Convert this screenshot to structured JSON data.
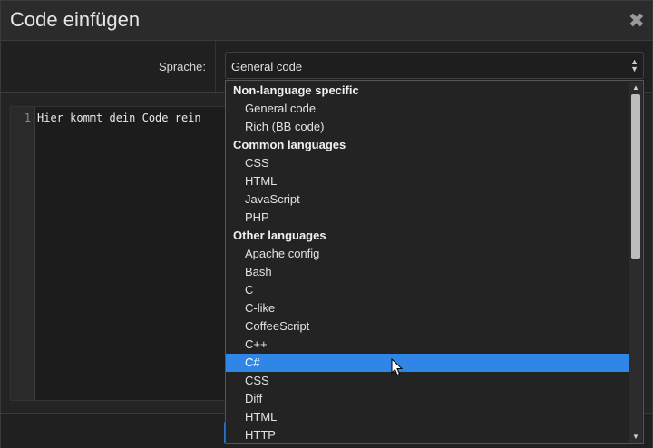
{
  "dialog": {
    "title": "Code einfügen",
    "close_glyph": "✖"
  },
  "form": {
    "language_label": "Sprache:",
    "language_value": "General code",
    "arrow_up": "▲",
    "arrow_down": "▼"
  },
  "editor": {
    "line_number": "1",
    "code": "Hier kommt dein Code rein"
  },
  "dropdown": {
    "options": [
      {
        "kind": "group",
        "label": "Non-language specific"
      },
      {
        "kind": "item",
        "label": "General code"
      },
      {
        "kind": "item",
        "label": "Rich (BB code)"
      },
      {
        "kind": "group",
        "label": "Common languages"
      },
      {
        "kind": "item",
        "label": "CSS"
      },
      {
        "kind": "item",
        "label": "HTML"
      },
      {
        "kind": "item",
        "label": "JavaScript"
      },
      {
        "kind": "item",
        "label": "PHP"
      },
      {
        "kind": "group",
        "label": "Other languages"
      },
      {
        "kind": "item",
        "label": "Apache config"
      },
      {
        "kind": "item",
        "label": "Bash"
      },
      {
        "kind": "item",
        "label": "C"
      },
      {
        "kind": "item",
        "label": "C-like"
      },
      {
        "kind": "item",
        "label": "CoffeeScript"
      },
      {
        "kind": "item",
        "label": "C++"
      },
      {
        "kind": "item",
        "label": "C#",
        "selected": true
      },
      {
        "kind": "item",
        "label": "CSS"
      },
      {
        "kind": "item",
        "label": "Diff"
      },
      {
        "kind": "item",
        "label": "HTML"
      },
      {
        "kind": "item",
        "label": "HTTP"
      }
    ],
    "scroll_up_glyph": "▲",
    "scroll_down_glyph": "▼"
  },
  "colors": {
    "accent": "#2f86e6",
    "background": "#242424"
  },
  "icons": {
    "close": "close-icon",
    "select_arrows": "sort-arrows-icon",
    "cursor": "mouse-pointer-icon"
  }
}
